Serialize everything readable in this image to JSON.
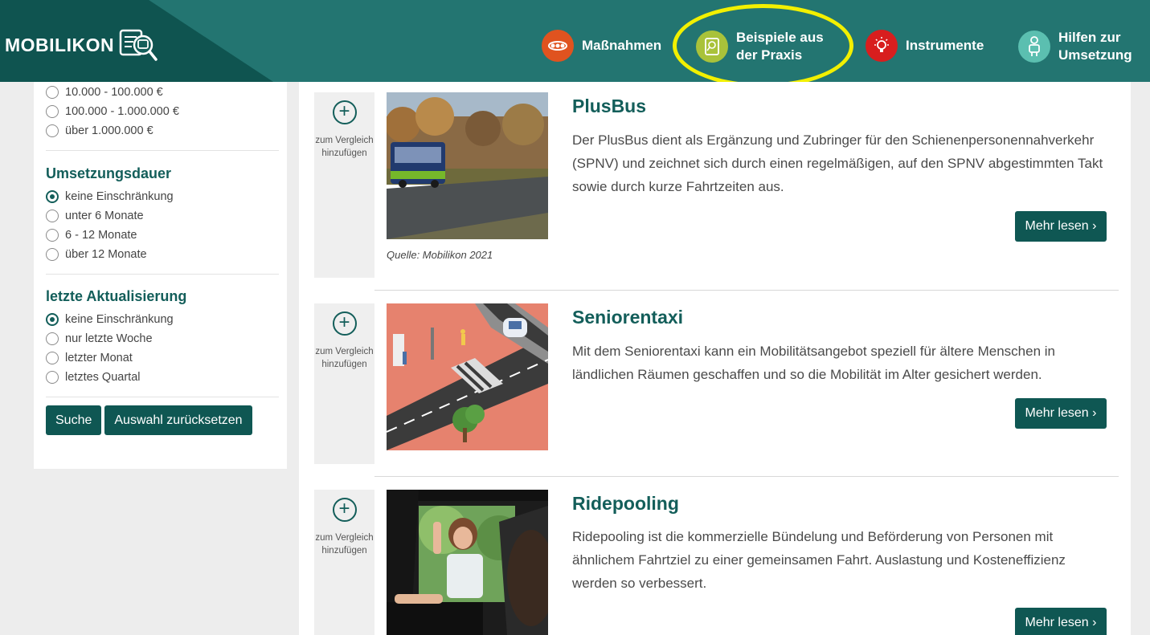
{
  "header": {
    "logo_text": "MOBILIKON",
    "nav": [
      {
        "label_line1": "Maßnahmen",
        "label_line2": "",
        "icon": "measures-icon",
        "color": "#e0531f"
      },
      {
        "label_line1": "Beispiele aus",
        "label_line2": "der Praxis",
        "icon": "document-search-icon",
        "color": "#a9c23a"
      },
      {
        "label_line1": "Instrumente",
        "label_line2": "",
        "icon": "lightbulb-icon",
        "color": "#d81e1e"
      },
      {
        "label_line1": "Hilfen zur",
        "label_line2": "Umsetzung",
        "icon": "person-icon",
        "color": "#5bbfb0"
      }
    ],
    "highlight_color": "#f2f000"
  },
  "sidebar": {
    "cost_options": [
      "10.000 - 100.000 €",
      "100.000 - 1.000.000 €",
      "über 1.000.000 €"
    ],
    "duration": {
      "title": "Umsetzungsdauer",
      "options": [
        "keine Einschränkung",
        "unter 6 Monate",
        "6 - 12 Monate",
        "über 12 Monate"
      ],
      "selected": "keine Einschränkung"
    },
    "update": {
      "title": "letzte Aktualisierung",
      "options": [
        "keine Einschränkung",
        "nur letzte Woche",
        "letzter Monat",
        "letztes Quartal"
      ],
      "selected": "keine Einschränkung"
    },
    "search_button": "Suche",
    "reset_button": "Auswahl zurücksetzen"
  },
  "entries": [
    {
      "title": "PlusBus",
      "text": "Der PlusBus dient als Ergänzung und Zubringer für den Schienenpersonennahverkehr (SPNV) und zeichnet sich durch einen regelmäßigen, auf den SPNV abgestimmten Takt sowie durch kurze Fahrtzeiten aus.",
      "caption": "Quelle: Mobilikon 2021",
      "compare_label": "zum Vergleich hinzufügen",
      "more_label": "Mehr lesen ›"
    },
    {
      "title": "Seniorentaxi",
      "text": "Mit dem Seniorentaxi kann ein Mobilitätsangebot speziell für ältere Menschen in ländlichen Räumen geschaffen und so die Mobilität im Alter gesichert werden.",
      "caption": "",
      "compare_label": "zum Vergleich hinzufügen",
      "more_label": "Mehr lesen ›"
    },
    {
      "title": "Ridepooling",
      "text": "Ridepooling ist die kommerzielle Bündelung und Beförderung von Personen mit ähnlichem Fahrtziel zu einer gemeinsamen Fahrt. Auslastung und Kosteneffizienz werden so verbessert.",
      "caption": "",
      "compare_label": "zum Vergleich hinzufügen",
      "more_label": "Mehr lesen ›"
    }
  ],
  "colors": {
    "primary": "#135e5a",
    "button": "#0f5753",
    "background": "#ededed"
  }
}
